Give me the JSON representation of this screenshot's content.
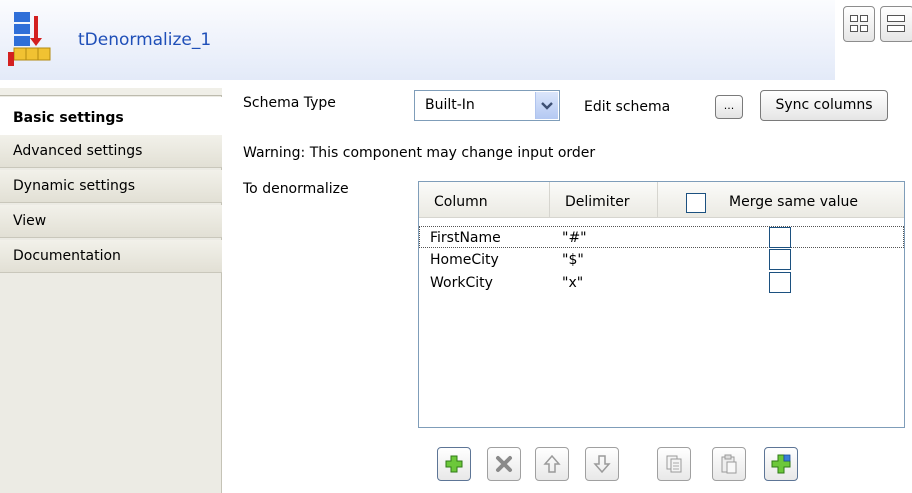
{
  "header": {
    "title": "tDenormalize_1"
  },
  "sidebar": {
    "tabs": [
      {
        "label": "Basic settings",
        "active": true
      },
      {
        "label": "Advanced settings",
        "active": false
      },
      {
        "label": "Dynamic settings",
        "active": false
      },
      {
        "label": "View",
        "active": false
      },
      {
        "label": "Documentation",
        "active": false
      }
    ]
  },
  "main": {
    "schema_type_label": "Schema Type",
    "schema_type_value": "Built-In",
    "edit_schema_label": "Edit schema",
    "edit_schema_button": "...",
    "sync_columns_button": "Sync columns",
    "warning": "Warning: This component may change input order",
    "to_denormalize_label": "To denormalize"
  },
  "table": {
    "headers": {
      "column": "Column",
      "delimiter": "Delimiter",
      "merge": "Merge same value"
    },
    "rows": [
      {
        "column": "FirstName",
        "delimiter": "\"#\"",
        "merge": false
      },
      {
        "column": "HomeCity",
        "delimiter": "\"$\"",
        "merge": false
      },
      {
        "column": "WorkCity",
        "delimiter": "\"x\"",
        "merge": false
      }
    ]
  },
  "toolbar": {
    "buttons": [
      {
        "icon": "add-icon",
        "enabled": true
      },
      {
        "icon": "delete-icon",
        "enabled": false
      },
      {
        "icon": "move-up-icon",
        "enabled": false
      },
      {
        "icon": "move-down-icon",
        "enabled": false
      },
      {
        "icon": "copy-icon",
        "enabled": false
      },
      {
        "icon": "paste-icon",
        "enabled": false
      },
      {
        "icon": "add-all-icon",
        "enabled": true
      }
    ]
  }
}
